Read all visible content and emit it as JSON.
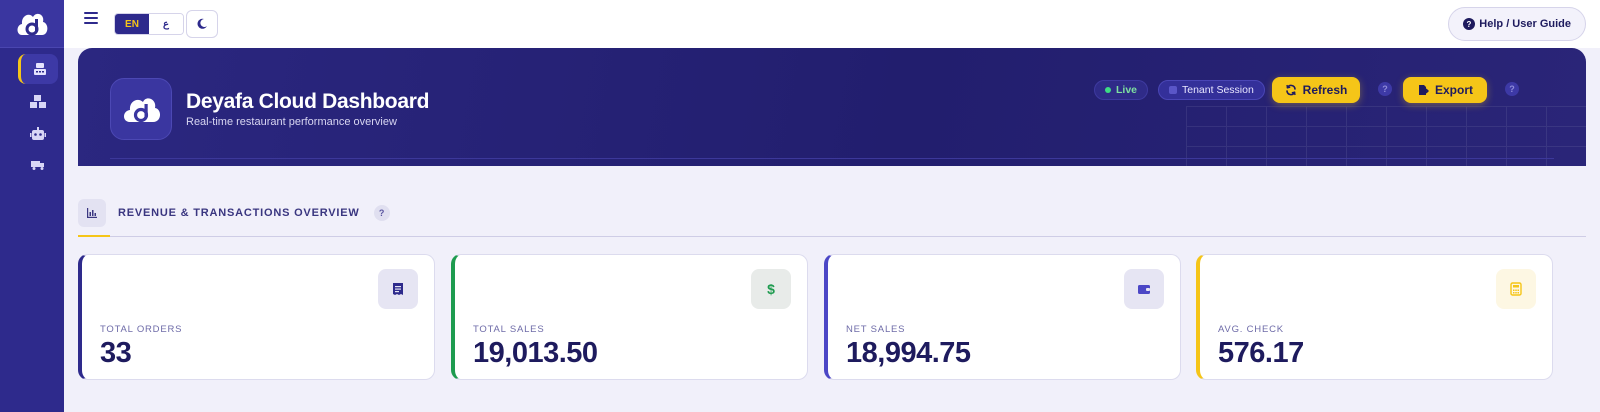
{
  "topbar": {
    "lang_en": "EN",
    "lang_ar": "ع",
    "help_label": "Help / User Guide"
  },
  "hero": {
    "title": "Deyafa Cloud Dashboard",
    "subtitle": "Real-time restaurant performance overview",
    "live_label": "Live",
    "tenant_label": "Tenant Session",
    "refresh_label": "Refresh",
    "export_label": "Export"
  },
  "section": {
    "title": "REVENUE & TRANSACTIONS OVERVIEW"
  },
  "cards": [
    {
      "label": "TOTAL ORDERS",
      "value": "33",
      "icon": "receipt-icon",
      "accent": "#2e2a8c"
    },
    {
      "label": "TOTAL SALES",
      "value": "19,013.50",
      "icon": "dollar-icon",
      "accent": "#1e9b4f"
    },
    {
      "label": "NET SALES",
      "value": "18,994.75",
      "icon": "wallet-icon",
      "accent": "#4c47c6"
    },
    {
      "label": "AVG. CHECK",
      "value": "576.17",
      "icon": "calculator-icon",
      "accent": "#f5c518"
    }
  ],
  "colors": {
    "brand": "#2e2a8c",
    "accent": "#f5c518",
    "success": "#1e9b4f"
  }
}
